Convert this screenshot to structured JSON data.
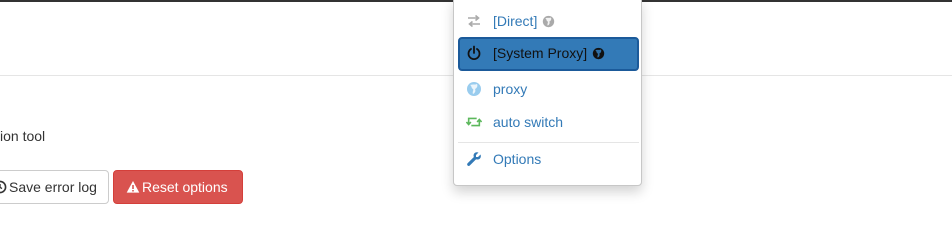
{
  "page": {
    "description_text": "ion tool"
  },
  "buttons": {
    "save_error_log": "Save error log",
    "reset_options": "Reset options"
  },
  "menu": {
    "items": [
      {
        "label": "[Direct]",
        "icon": "transfer-icon",
        "badge_icon": "globe-icon",
        "color": "#337ab7",
        "active": false
      },
      {
        "label": "[System Proxy]",
        "icon": "power-icon",
        "badge_icon": "globe-icon",
        "color": "#337ab7",
        "active": true
      },
      {
        "label": "proxy",
        "icon": "globe-icon",
        "color": "#99ccee",
        "active": false
      },
      {
        "label": "auto switch",
        "icon": "retweet-icon",
        "color": "#5cb85c",
        "active": false
      },
      {
        "label": "Options",
        "icon": "wrench-icon",
        "color": "#337ab7",
        "active": false
      }
    ]
  },
  "colors": {
    "link": "#337ab7",
    "active_bg": "#337ab7",
    "danger": "#d9534f",
    "auto_switch_icon": "#5cb85c",
    "proxy_icon": "#99ccee"
  }
}
